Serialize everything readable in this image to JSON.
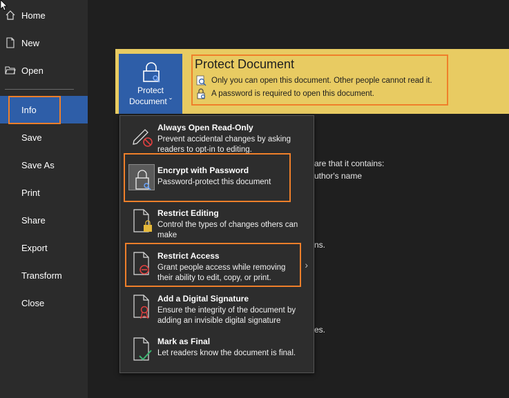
{
  "sidebar": {
    "items": [
      {
        "label": "Home"
      },
      {
        "label": "New"
      },
      {
        "label": "Open"
      },
      {
        "label": "Info"
      },
      {
        "label": "Save"
      },
      {
        "label": "Save As"
      },
      {
        "label": "Print"
      },
      {
        "label": "Share"
      },
      {
        "label": "Export"
      },
      {
        "label": "Transform"
      },
      {
        "label": "Close"
      }
    ]
  },
  "protect": {
    "button_line1": "Protect",
    "button_line2": "Document ˇ",
    "title": "Protect Document",
    "line1": "Only you can open this document. Other people cannot read it.",
    "line2": "A password is required to open this document."
  },
  "background": {
    "t1": "are that it contains:",
    "t2": "uthor's name",
    "t3": "ns.",
    "t4": "es."
  },
  "menu": {
    "items": [
      {
        "title": "Always Open Read-Only",
        "desc": "Prevent accidental changes by asking readers to opt-in to editing."
      },
      {
        "title": "Encrypt with Password",
        "desc": "Password-protect this document"
      },
      {
        "title": "Restrict Editing",
        "desc": "Control the types of changes others can make"
      },
      {
        "title": "Restrict Access",
        "desc": "Grant people access while removing their ability to edit, copy, or print.",
        "chevron": "›"
      },
      {
        "title": "Add a Digital Signature",
        "desc": "Ensure the integrity of the document by adding an invisible digital signature"
      },
      {
        "title": "Mark as Final",
        "desc": "Let readers know the document is final."
      }
    ]
  },
  "colors": {
    "accent": "#2e5ea8",
    "highlight": "#ef7f2a",
    "band": "#e8cb62"
  }
}
